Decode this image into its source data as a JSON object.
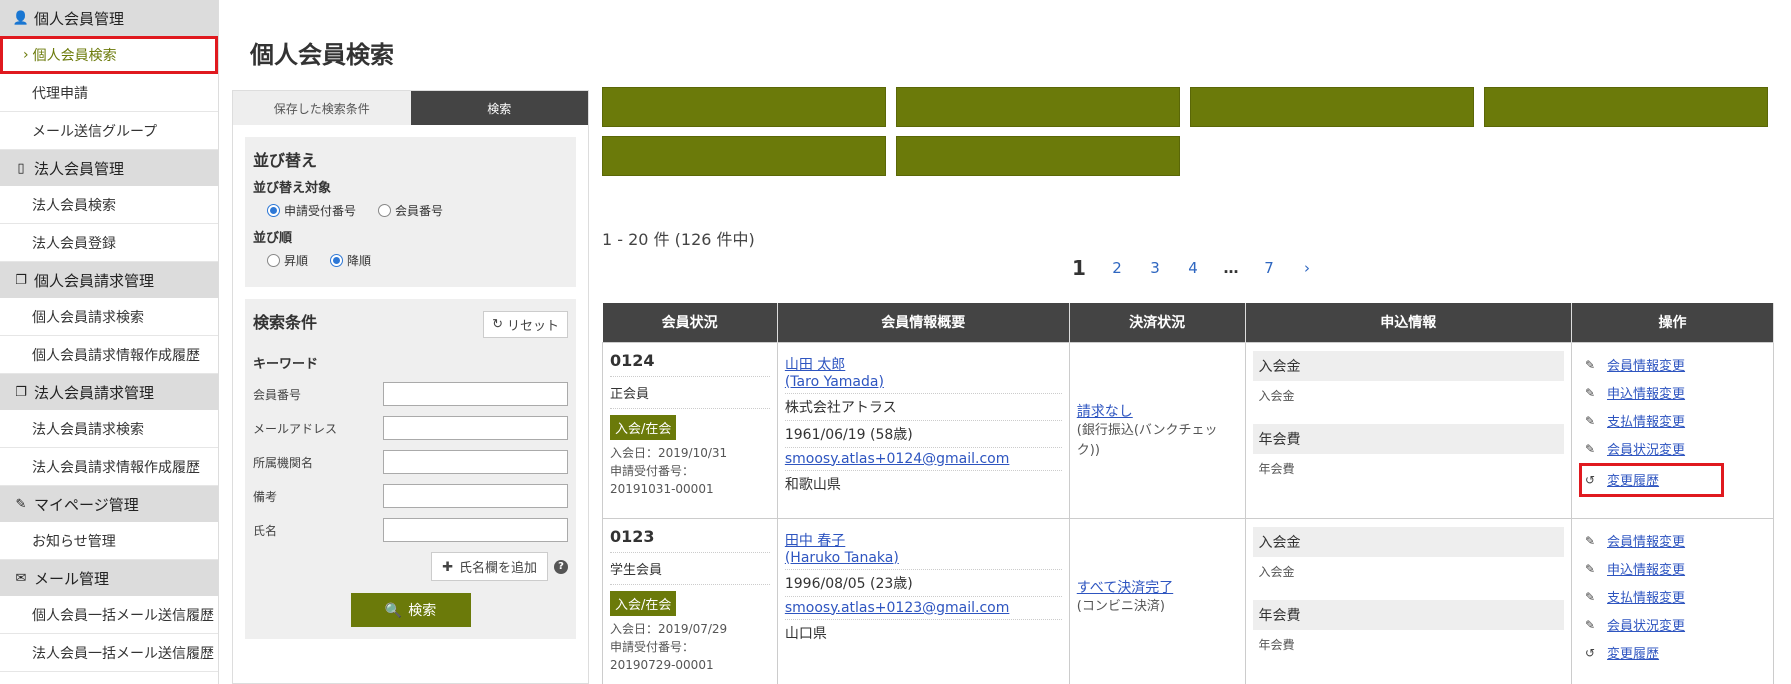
{
  "sidebar": {
    "sections": [
      {
        "label": "個人会員管理",
        "icon": "person-icon",
        "items": [
          {
            "label": "個人会員検索",
            "active": true
          },
          {
            "label": "代理申請"
          },
          {
            "label": "メール送信グループ"
          }
        ]
      },
      {
        "label": "法人会員管理",
        "icon": "building-icon",
        "items": [
          {
            "label": "法人会員検索"
          },
          {
            "label": "法人会員登録"
          }
        ]
      },
      {
        "label": "個人会員請求管理",
        "icon": "documents-icon",
        "items": [
          {
            "label": "個人会員請求検索"
          },
          {
            "label": "個人会員請求情報作成履歴"
          }
        ]
      },
      {
        "label": "法人会員請求管理",
        "icon": "documents-icon",
        "items": [
          {
            "label": "法人会員請求検索"
          },
          {
            "label": "法人会員請求情報作成履歴"
          }
        ]
      },
      {
        "label": "マイページ管理",
        "icon": "pencil-icon",
        "items": [
          {
            "label": "お知らせ管理"
          }
        ]
      },
      {
        "label": "メール管理",
        "icon": "envelope-icon",
        "items": [
          {
            "label": "個人会員一括メール送信履歴"
          },
          {
            "label": "法人会員一括メール送信履歴"
          }
        ]
      }
    ]
  },
  "page_title": "個人会員検索",
  "search_panel": {
    "tab_saved": "保存した検索条件",
    "tab_search": "検索",
    "sort": {
      "title": "並び替え",
      "target_label": "並び替え対象",
      "target_options": [
        "申請受付番号",
        "会員番号"
      ],
      "target_selected": "申請受付番号",
      "order_label": "並び順",
      "order_options": [
        "昇順",
        "降順"
      ],
      "order_selected": "降順"
    },
    "conditions": {
      "title": "検索条件",
      "reset_label": "リセット",
      "keyword_label": "キーワード",
      "fields": [
        "会員番号",
        "メールアドレス",
        "所属機関名",
        "備考",
        "氏名"
      ],
      "add_name_label": "氏名欄を追加",
      "search_label": "検索"
    }
  },
  "results": {
    "count_text": "1 - 20 件 (126 件中)",
    "pager": {
      "current": "1",
      "pages": [
        "2",
        "3",
        "4"
      ],
      "ellipsis": "…",
      "last": "7",
      "next": "›"
    },
    "columns": [
      "会員状況",
      "会員情報概要",
      "決済状況",
      "申込情報",
      "操作"
    ],
    "rows": [
      {
        "member_no": "0124",
        "member_type": "正会員",
        "status": "入会/在会",
        "join_date": "入会日：2019/10/31",
        "app_no_label": "申請受付番号：",
        "app_no": "20191031-00001",
        "name": "山田 太郎",
        "name_en": "(Taro Yamada)",
        "company": "株式会社アトラス",
        "birth": "1961/06/19 (58歳)",
        "email": "smoosy.atlas+0124@gmail.com",
        "prefecture": "和歌山県",
        "payment": "請求なし",
        "payment_sub": "(銀行振込(バンクチェック))",
        "apply": [
          {
            "head": "入会金",
            "val": "入会金"
          },
          {
            "head": "年会費",
            "val": "年会費"
          }
        ],
        "ops": [
          "会員情報変更",
          "申込情報変更",
          "支払情報変更",
          "会員状況変更",
          "変更履歴"
        ]
      },
      {
        "member_no": "0123",
        "member_type": "学生会員",
        "status": "入会/在会",
        "join_date": "入会日：2019/07/29",
        "app_no_label": "申請受付番号：",
        "app_no": "20190729-00001",
        "name": "田中 春子",
        "name_en": "(Haruko Tanaka)",
        "company": "",
        "birth": "1996/08/05 (23歳)",
        "email": "smoosy.atlas+0123@gmail.com",
        "prefecture": "山口県",
        "payment": "すべて決済完了",
        "payment_sub": "(コンビニ決済)",
        "apply": [
          {
            "head": "入会金",
            "val": "入会金"
          },
          {
            "head": "年会費",
            "val": "年会費"
          }
        ],
        "ops": [
          "会員情報変更",
          "申込情報変更",
          "支払情報変更",
          "会員状況変更",
          "変更履歴"
        ]
      }
    ]
  },
  "colors": {
    "accent": "#6b7a0a",
    "highlight": "#e0191f",
    "link": "#2e55c0",
    "header": "#444444"
  }
}
